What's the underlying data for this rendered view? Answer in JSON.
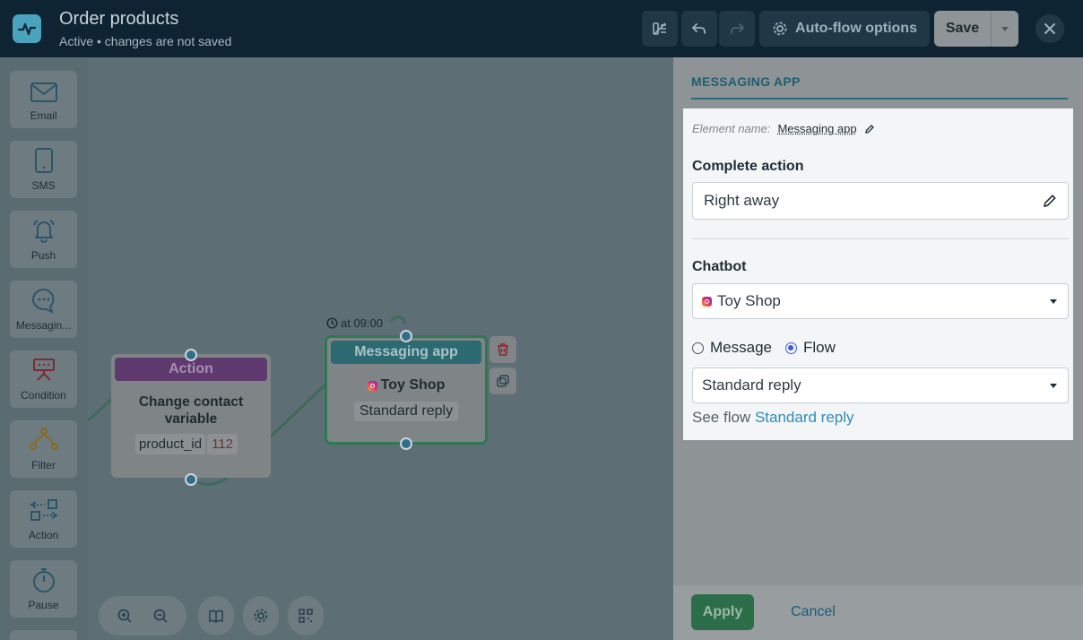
{
  "header": {
    "title": "Order products",
    "status": "Active • changes are not saved",
    "autoflow_label": "Auto-flow options",
    "save_label": "Save"
  },
  "toolbox": {
    "items": [
      {
        "label": "Email",
        "icon": "envelope-icon"
      },
      {
        "label": "SMS",
        "icon": "phone-icon"
      },
      {
        "label": "Push",
        "icon": "bell-icon"
      },
      {
        "label": "Messagin...",
        "icon": "chat-bubble-icon"
      },
      {
        "label": "Condition",
        "icon": "condition-icon"
      },
      {
        "label": "Filter",
        "icon": "filter-icon"
      },
      {
        "label": "Action",
        "icon": "action-icon"
      },
      {
        "label": "Pause",
        "icon": "stopwatch-icon"
      }
    ]
  },
  "canvas": {
    "action_node": {
      "header": "Action",
      "title": "Change contact variable",
      "variable": "product_id",
      "value": "112"
    },
    "message_node": {
      "schedule": "at 09:00",
      "header": "Messaging app",
      "bot": "Toy Shop",
      "flow": "Standard reply"
    }
  },
  "panel": {
    "title": "MESSAGING APP",
    "element_name_label": "Element name:",
    "element_name": "Messaging app",
    "complete_action_label": "Complete action",
    "complete_action_value": "Right away",
    "chatbot_label": "Chatbot",
    "chatbot_value": "Toy Shop",
    "radio_message": "Message",
    "radio_flow": "Flow",
    "flow_value": "Standard reply",
    "see_flow_prefix": "See flow",
    "see_flow_link": "Standard reply",
    "apply_label": "Apply",
    "cancel_label": "Cancel"
  },
  "colors": {
    "topbar": "#0f2432",
    "accent": "#4aa3bd",
    "apply": "#2d6e4a",
    "action_header": "#5f3a6e",
    "message_header": "#2c6a72"
  }
}
